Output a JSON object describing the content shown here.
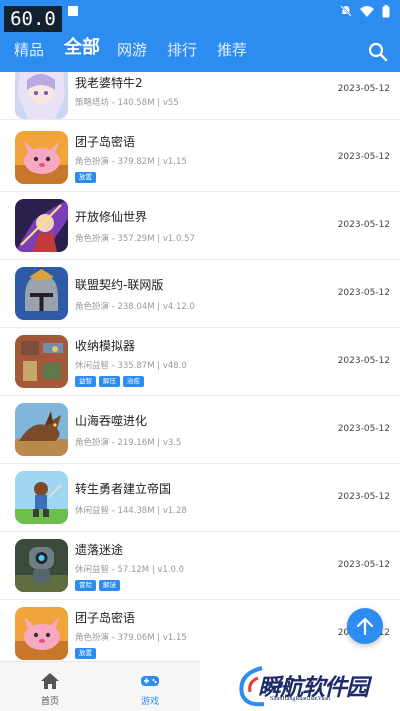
{
  "status_bar": {
    "fps": "60.0"
  },
  "tabs": [
    {
      "label": "精品"
    },
    {
      "label": "全部"
    },
    {
      "label": "网游"
    },
    {
      "label": "排行"
    },
    {
      "label": "推荐"
    }
  ],
  "active_tab": "全部",
  "games": [
    {
      "title": "我老婆特牛2",
      "meta": "策略塔坊 - 140.58M | v55",
      "date": "2023-05-12",
      "tags": [],
      "icon": "anime-girl-icon"
    },
    {
      "title": "团子岛密语",
      "meta": "角色扮演 - 379.82M | v1.15",
      "date": "2023-05-12",
      "tags": [
        "放置"
      ],
      "icon": "pink-creature-icon"
    },
    {
      "title": "开放修仙世界",
      "meta": "角色扮演 - 357.29M | v1.0.57",
      "date": "2023-05-12",
      "tags": [],
      "icon": "warrior-icon"
    },
    {
      "title": "联盟契约-联网版",
      "meta": "角色扮演 - 238.04M | v4.12.0",
      "date": "2023-05-12",
      "tags": [],
      "icon": "knight-helmet-icon"
    },
    {
      "title": "收纳模拟器",
      "meta": "休闲益智 - 335.87M | v48.0",
      "date": "2023-05-12",
      "tags": [
        "益智",
        "解压",
        "治愈"
      ],
      "icon": "room-icon"
    },
    {
      "title": "山海吞噬进化",
      "meta": "角色扮演 - 219.16M | v3.5",
      "date": "2023-05-12",
      "tags": [],
      "icon": "beast-icon"
    },
    {
      "title": "转生勇者建立帝国",
      "meta": "休闲益智 - 144.38M | v1.28",
      "date": "2023-05-12",
      "tags": [],
      "icon": "hero-icon"
    },
    {
      "title": "遗落迷途",
      "meta": "休闲益智 - 57.12M | v1.0.0",
      "date": "2023-05-12",
      "tags": [
        "冒险",
        "解谜"
      ],
      "icon": "robot-icon"
    },
    {
      "title": "团子岛密语",
      "meta": "角色扮演 - 379.06M | v1.15",
      "date": "2023-05-12",
      "tags": [
        "放置"
      ],
      "icon": "pink-creature-icon"
    }
  ],
  "bottom_nav": [
    {
      "label": "首页",
      "icon": "home-icon"
    },
    {
      "label": "游戏",
      "icon": "gamepad-icon"
    }
  ],
  "watermark": {
    "text": "瞬航软件园",
    "sub": "ShunHangRuanJianYuan"
  },
  "colors": {
    "accent": "#2d8cf0",
    "title": "#222222",
    "meta": "#999999"
  }
}
